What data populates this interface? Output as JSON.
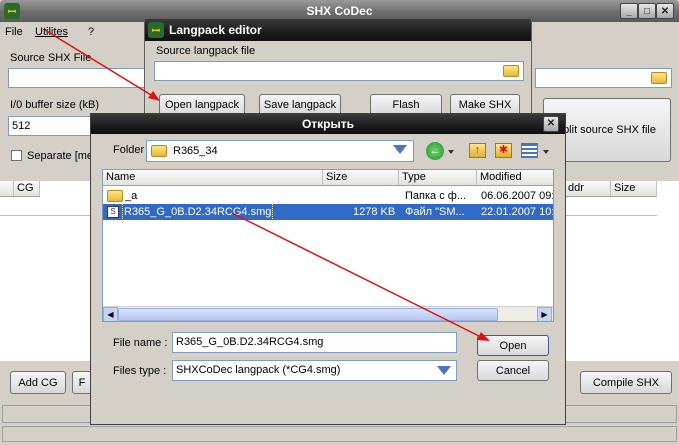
{
  "main": {
    "title": "SHX CoDec",
    "menu": [
      "File",
      "Utilites",
      "?"
    ],
    "source_label": "Source SHX File",
    "buffer_label": "I/0 buffer size (kB)",
    "buffer_value": "512",
    "separate_label": "Separate [me",
    "split_button": "plit source SHX file",
    "table_headers": [
      "CG",
      "ddr",
      "Size"
    ],
    "add_cg": "Add CG",
    "f_button": "F",
    "compile_shx": "Compile SHX"
  },
  "langpack": {
    "title": "Langpack editor",
    "source_label": "Source langpack file",
    "open_langpack": "Open langpack",
    "save_langpack": "Save langpack",
    "flash": "Flash",
    "make_shx": "Make SHX"
  },
  "dialog": {
    "title": "Открыть",
    "folder_label": "Folder",
    "folder_value": "R365_34",
    "columns": [
      "Name",
      "Size",
      "Type",
      "Modified"
    ],
    "files": [
      {
        "name": "_a",
        "size": "",
        "type": "Папка с ф...",
        "modified": "06.06.2007 09:0",
        "icon": "folder-icon"
      },
      {
        "name": "R365_G_0B.D2.34RCG4.smg",
        "size": "1278 KB",
        "type": "Файл \"SM...",
        "modified": "22.01.2007 10:2",
        "icon": "file-icon"
      }
    ],
    "filename_label": "File name :",
    "filename_value": "R365_G_0B.D2.34RCG4.smg",
    "filetype_label": "Files type :",
    "filetype_value": "SHXCoDec langpack (*CG4.smg)",
    "open_button": "Open",
    "cancel_button": "Cancel"
  },
  "colors": {
    "selection": "#316ac5",
    "arrow": "#e01010"
  }
}
